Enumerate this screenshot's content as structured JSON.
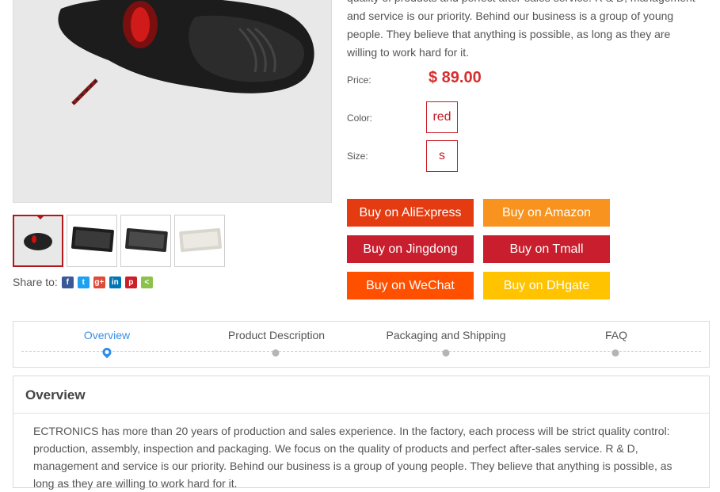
{
  "product": {
    "description": "quality of products and perfect after-sales service. R & D, management and service is our priority. Behind our business is a group of young people. They believe that anything is possible, as long as they are willing to work hard for it.",
    "price_label": "Price:",
    "price": "$ 89.00",
    "color_label": "Color:",
    "color_value": "red",
    "size_label": "Size:",
    "size_value": "s"
  },
  "buttons": [
    {
      "label": "Buy on AliExpress",
      "color": "#e43b11"
    },
    {
      "label": "Buy on Amazon",
      "color": "#f7931e"
    },
    {
      "label": "Buy on Jingdong",
      "color": "#c81e2d"
    },
    {
      "label": "Buy on Tmall",
      "color": "#c81e2d"
    },
    {
      "label": "Buy on WeChat",
      "color": "#ff5000"
    },
    {
      "label": "Buy on DHgate",
      "color": "#ffc300"
    }
  ],
  "share": {
    "label": "Share to:",
    "icons": [
      "facebook-icon",
      "twitter-icon",
      "google-plus-icon",
      "linkedin-icon",
      "pinterest-icon",
      "share-icon"
    ]
  },
  "tabs": [
    {
      "label": "Overview",
      "active": true
    },
    {
      "label": "Product Description",
      "active": false
    },
    {
      "label": "Packaging and Shipping",
      "active": false
    },
    {
      "label": "FAQ",
      "active": false
    }
  ],
  "overview": {
    "title": "Overview",
    "text": "ECTRONICS has more than 20 years of production and sales experience. In the factory, each process will be strict quality control: production, assembly, inspection and packaging. We focus on the quality of products and perfect after-sales service. R & D, management and service is our priority. Behind our business is a group of young people. They believe that anything is possible, as long as they are willing to work hard for it."
  },
  "colors": {
    "accent_red": "#c91b24",
    "price_red": "#d72e2e",
    "active_tab_blue": "#3a8ee6"
  }
}
